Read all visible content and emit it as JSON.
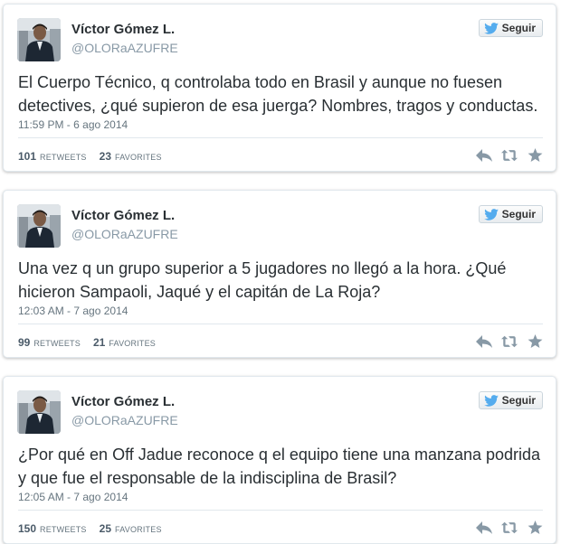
{
  "follow_label": "Seguir",
  "icons": {
    "avatar": "profile-photo",
    "follow": "twitter-bird-icon",
    "reply": "reply-icon",
    "retweet": "retweet-icon",
    "favorite": "star-icon"
  },
  "colors": {
    "bird": "#55acee",
    "action_icon": "#8899a6",
    "username": "#8899a6",
    "stat_number": "#4a5a68"
  },
  "tweets": [
    {
      "fullname": "Víctor Gómez L.",
      "username": "@OLORaAZUFRE",
      "text": "El Cuerpo Técnico, q controlaba todo en Brasil y aunque no fuesen detectives, ¿qué supieron de esa juerga? Nombres, tragos y conductas.",
      "timestamp": "11:59 PM - 6 ago 2014",
      "retweets_count": "101",
      "retweets_label": "RETWEETS",
      "favorites_count": "23",
      "favorites_label": "FAVORITES"
    },
    {
      "fullname": "Víctor Gómez L.",
      "username": "@OLORaAZUFRE",
      "text": "Una vez q un grupo superior a 5 jugadores no llegó a la hora. ¿Qué hicieron Sampaoli, Jaqué y el capitán de La Roja?",
      "timestamp": "12:03 AM - 7 ago 2014",
      "retweets_count": "99",
      "retweets_label": "RETWEETS",
      "favorites_count": "21",
      "favorites_label": "FAVORITES"
    },
    {
      "fullname": "Víctor Gómez L.",
      "username": "@OLORaAZUFRE",
      "text": "¿Por qué en Off Jadue reconoce q el equipo tiene una manzana podrida y que fue el responsable de la indisciplina de Brasil?",
      "timestamp": "12:05 AM - 7 ago 2014",
      "retweets_count": "150",
      "retweets_label": "RETWEETS",
      "favorites_count": "25",
      "favorites_label": "FAVORITES"
    }
  ]
}
